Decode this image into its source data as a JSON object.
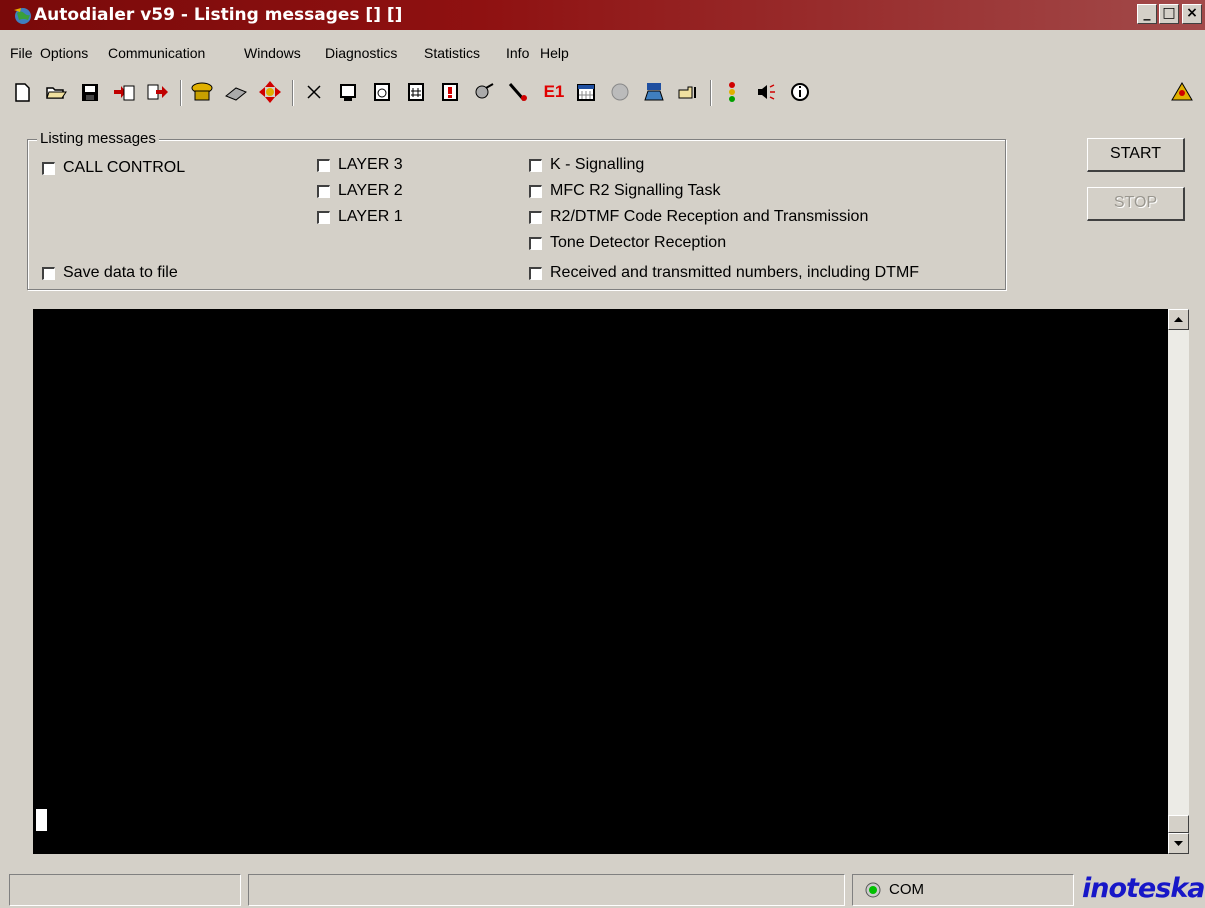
{
  "window": {
    "title": "Autodialer v59 - Listing messages [] []",
    "controls": {
      "minimize": "_",
      "maximize": "□",
      "close": "×"
    }
  },
  "menu": [
    "File",
    "Options",
    "Communication",
    "Windows",
    "Diagnostics",
    "Statistics",
    "Info",
    "Help"
  ],
  "toolbar": {
    "e1_label": "E1",
    "icons": [
      "new-file-icon",
      "open-folder-icon",
      "save-disk-icon",
      "import-icon",
      "export-icon",
      "phone-icon",
      "modem-icon",
      "move-arrows-icon",
      "scissors-icon",
      "monitor-icon",
      "clock-icon",
      "hash-icon",
      "alert-icon",
      "tools-icon",
      "cable-icon",
      "e1-icon",
      "calendar-icon",
      "globe-icon",
      "cli-phone-icon",
      "pointer-icon",
      "traffic-light-icon",
      "speaker-icon",
      "info-icon",
      "warning-icon"
    ]
  },
  "listing": {
    "title": "Listing messages",
    "call_control": "CALL CONTROL",
    "layer3": "LAYER 3",
    "layer2": "LAYER 2",
    "layer1": "LAYER 1",
    "k_signalling": "K - Signalling",
    "mfc_r2": "MFC R2 Signalling Task",
    "r2_dtmf": "R2/DTMF Code Reception and Transmission",
    "tone_detector": "Tone Detector Reception",
    "received_numbers": "Received and transmitted numbers, including DTMF",
    "save_file": "Save data to file"
  },
  "buttons": {
    "start": "START",
    "stop": "STOP"
  },
  "status": {
    "com": "COM",
    "brand": "inoteska"
  },
  "colors": {
    "titlebar": "#8f1111",
    "console": "#000000",
    "brand": "#1717c8",
    "e1": "#e00000"
  }
}
